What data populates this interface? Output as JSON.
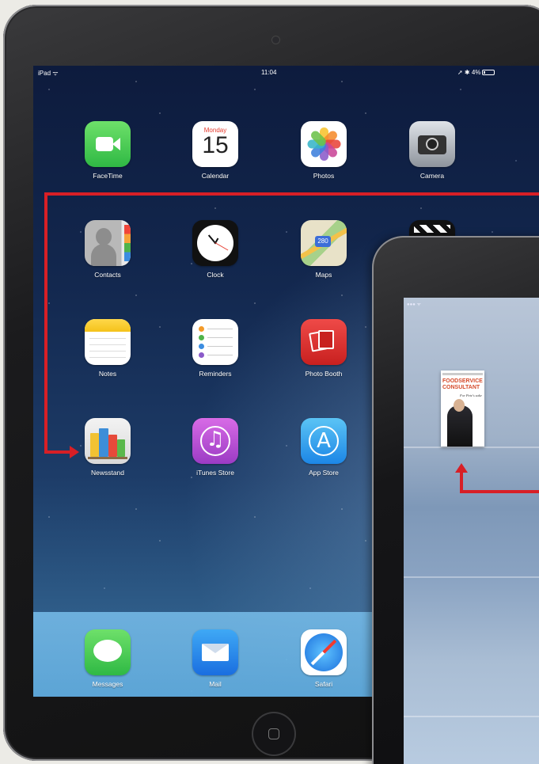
{
  "status_bar": {
    "device": "iPad",
    "time": "11:04",
    "battery": "4%"
  },
  "home_screen": {
    "rows": [
      [
        {
          "label": "FaceTime",
          "icon": "facetime-icon"
        },
        {
          "label": "Calendar",
          "icon": "calendar-icon",
          "month": "Monday",
          "day": "15"
        },
        {
          "label": "Photos",
          "icon": "photos-icon"
        },
        {
          "label": "Camera",
          "icon": "camera-icon"
        }
      ],
      [
        {
          "label": "Contacts",
          "icon": "contacts-icon"
        },
        {
          "label": "Clock",
          "icon": "clock-icon"
        },
        {
          "label": "Maps",
          "icon": "maps-icon",
          "badge": "280"
        }
      ],
      [
        {
          "label": "Notes",
          "icon": "notes-icon"
        },
        {
          "label": "Reminders",
          "icon": "reminders-icon"
        },
        {
          "label": "Photo Booth",
          "icon": "photo-booth-icon"
        }
      ],
      [
        {
          "label": "Newsstand",
          "icon": "newsstand-icon"
        },
        {
          "label": "iTunes Store",
          "icon": "itunes-store-icon"
        },
        {
          "label": "App Store",
          "icon": "app-store-icon"
        }
      ]
    ],
    "dock": [
      {
        "label": "Messages",
        "icon": "messages-icon"
      },
      {
        "label": "Mail",
        "icon": "mail-icon"
      },
      {
        "label": "Safari",
        "icon": "safari-icon"
      }
    ]
  },
  "newsstand_screen": {
    "magazine": {
      "title_line1": "FOODSERVICE",
      "title_line2": "CONSULTANT",
      "strapline": "For Pete's sake"
    }
  },
  "colors": {
    "annotation_arrow": "#d81f26",
    "dock": "#6fb8e6"
  }
}
